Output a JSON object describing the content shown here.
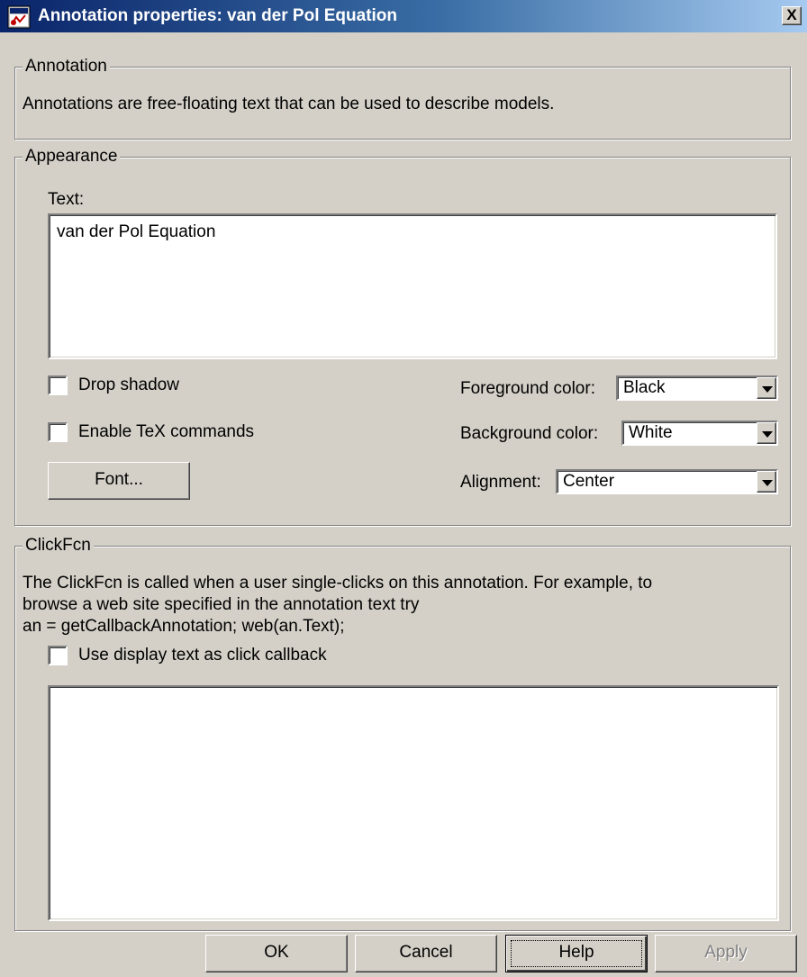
{
  "window": {
    "title": "Annotation properties: van der Pol Equation",
    "close_glyph": "X",
    "icon": "simulink-model-icon"
  },
  "annotation_group": {
    "legend": "Annotation",
    "description": "Annotations are free-floating text that can be used to describe models."
  },
  "appearance_group": {
    "legend": "Appearance",
    "text_label": "Text:",
    "text_value": "van der Pol Equation",
    "drop_shadow": {
      "label": "Drop shadow",
      "checked": false
    },
    "enable_tex": {
      "label": "Enable TeX commands",
      "checked": false
    },
    "font_button": "Font...",
    "foreground": {
      "label": "Foreground color:",
      "value": "Black"
    },
    "background": {
      "label": "Background color:",
      "value": "White"
    },
    "alignment": {
      "label": "Alignment:",
      "value": "Center"
    }
  },
  "clickfcn_group": {
    "legend": "ClickFcn",
    "description_line1": "The ClickFcn is called when a user single-clicks on this annotation. For example, to",
    "description_line2": "browse a web site specified in the annotation text try",
    "description_line3": "an = getCallbackAnnotation; web(an.Text);",
    "use_display_text": {
      "label": "Use display text as click callback",
      "checked": false
    },
    "callback_value": ""
  },
  "buttons": {
    "ok": "OK",
    "cancel": "Cancel",
    "help": "Help",
    "apply": "Apply"
  },
  "colors": {
    "dialog_face": "#d4d0c8",
    "titlebar_start": "#0a246a",
    "titlebar_end": "#a6caf0"
  }
}
